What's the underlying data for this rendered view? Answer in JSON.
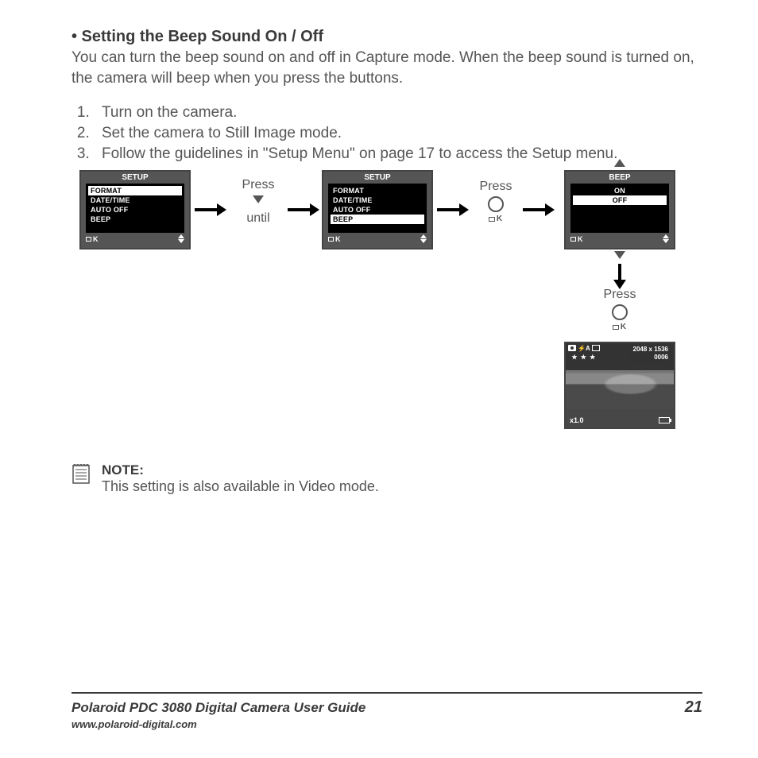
{
  "heading": "• Setting the Beep Sound On / Off",
  "intro": "You can turn the beep sound on and off in Capture mode. When the beep sound is turned on, the camera will beep when you press the buttons.",
  "steps": [
    "Turn on the camera.",
    "Set the camera to Still Image mode.",
    "Follow the guidelines in \"Setup Menu\" on page 17 to access the Setup menu."
  ],
  "screen1": {
    "title": "SETUP",
    "items": [
      "FORMAT",
      "DATE/TIME",
      "AUTO OFF",
      "BEEP"
    ],
    "selected": "FORMAT",
    "ok": "K"
  },
  "press1": {
    "label": "Press",
    "until": "until"
  },
  "screen2": {
    "title": "SETUP",
    "items": [
      "FORMAT",
      "DATE/TIME",
      "AUTO OFF",
      "BEEP"
    ],
    "selected": "BEEP",
    "ok": "K"
  },
  "press2": {
    "label": "Press",
    "ok": "K"
  },
  "screen3": {
    "title": "BEEP",
    "items": [
      "ON",
      "OFF"
    ],
    "selected": "OFF",
    "ok": "K"
  },
  "press3": {
    "label": "Press",
    "ok": "K"
  },
  "preview": {
    "flash": "⚡A",
    "resolution": "2048 x 1536",
    "count": "0006",
    "stars": "★ ★ ★",
    "zoom": "x1.0"
  },
  "note": {
    "label": "NOTE:",
    "text": "This setting is also available in Video mode."
  },
  "footer": {
    "guide": "Polaroid PDC 3080 Digital Camera User Guide",
    "page": "21",
    "url": "www.polaroid-digital.com"
  }
}
